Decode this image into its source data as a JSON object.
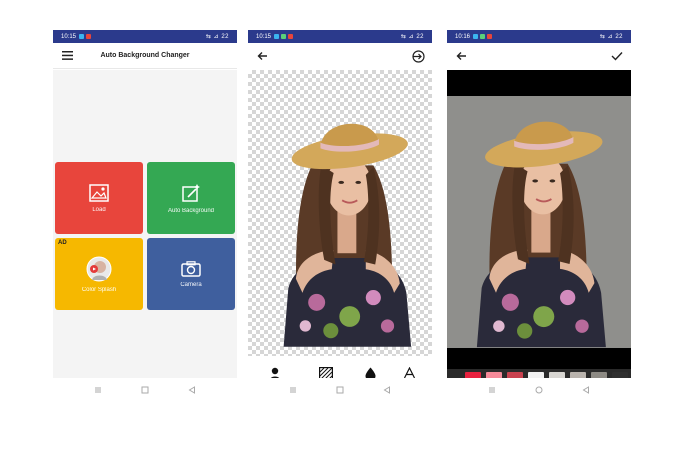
{
  "phone1": {
    "status": {
      "time": "10:15",
      "icons": "⇆ ⊿ 22"
    },
    "title": "Auto Background Changer",
    "tiles": [
      {
        "label": "Load",
        "color": "#e8453c"
      },
      {
        "label": "Auto Background",
        "color": "#34a853"
      },
      {
        "label": "Color Splash",
        "color": "#f6b800",
        "badge": "AD"
      },
      {
        "label": "Camera",
        "color": "#3f5f9e"
      }
    ]
  },
  "phone2": {
    "status": {
      "time": "10:15",
      "icons": "⇆ ⊿ 22"
    },
    "tools": [
      {
        "label": "Auto editing",
        "icon": "person-icon"
      },
      {
        "label": "Background",
        "icon": "pattern-icon"
      },
      {
        "label": "Blur",
        "icon": "drop-icon"
      },
      {
        "label": "Text",
        "icon": "text-icon"
      }
    ]
  },
  "phone3": {
    "status": {
      "time": "10:16",
      "icons": "⇆ ⊿ 22"
    },
    "swatches": [
      "#e8213f",
      "#f58a99",
      "#c9424f",
      "#f2f2f2",
      "#d8d6d2",
      "#b9b3ad",
      "#8d8a84",
      "#2f2f2f"
    ]
  }
}
